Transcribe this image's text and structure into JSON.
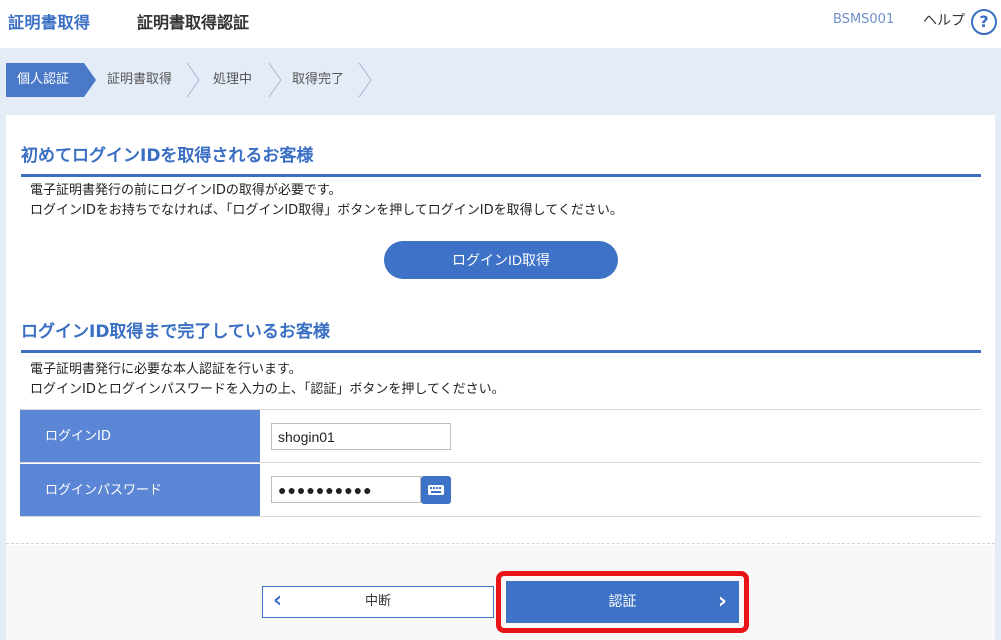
{
  "header": {
    "app_title": "証明書取得",
    "page_title": "証明書取得認証",
    "screen_id": "BSMS001",
    "help_label": "ヘルプ",
    "help_icon": "?"
  },
  "steps": [
    {
      "label": "個人認証",
      "active": true
    },
    {
      "label": "証明書取得",
      "active": false
    },
    {
      "label": "処理中",
      "active": false
    },
    {
      "label": "取得完了",
      "active": false
    }
  ],
  "section1": {
    "title": "初めてログインIDを取得されるお客様",
    "desc_line1": "電子証明書発行の前にログインIDの取得が必要です。",
    "desc_line2": "ログインIDをお持ちでなければ、「ログインID取得」ボタンを押してログインIDを取得してください。",
    "button_label": "ログインID取得"
  },
  "section2": {
    "title": "ログインID取得まで完了しているお客様",
    "desc_line1": "電子証明書発行に必要な本人認証を行います。",
    "desc_line2": "ログインIDとログインパスワードを入力の上、「認証」ボタンを押してください。"
  },
  "form": {
    "login_id_label": "ログインID",
    "login_id_value": "shogin01",
    "password_label": "ログインパスワード",
    "password_value": "●●●●●●●●●●"
  },
  "footer": {
    "back_label": "中断",
    "auth_label": "認証"
  },
  "colors": {
    "accent": "#3d72c7",
    "highlight": "#e8141a"
  }
}
